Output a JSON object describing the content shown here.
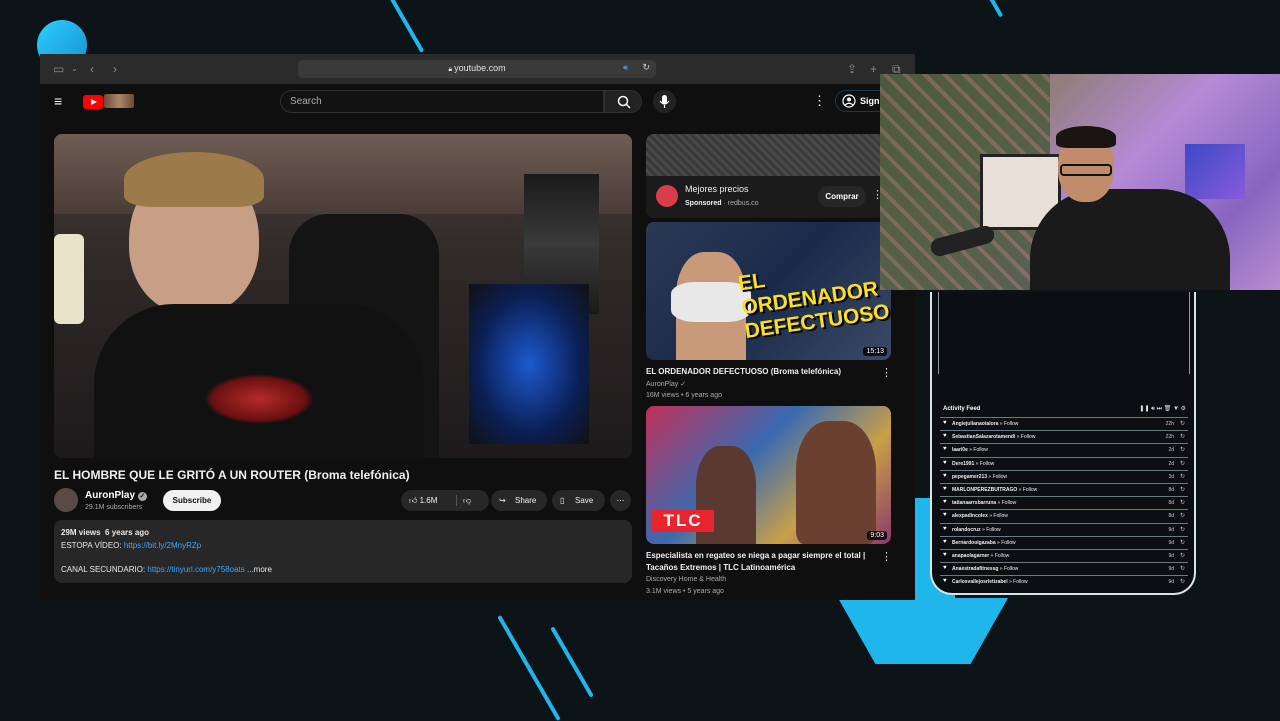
{
  "browser": {
    "url": "youtube.com"
  },
  "youtube": {
    "search_placeholder": "Search",
    "sign_in": "Sign",
    "video": {
      "title": "EL HOMBRE QUE LE GRITÓ A UN ROUTER (Broma telefónica)",
      "channel": "AuronPlay",
      "subscribers": "29.1M subscribers",
      "subscribe_label": "Subscribe",
      "likes": "1.6M",
      "share_label": "Share",
      "save_label": "Save",
      "views": "29M views",
      "age": "6 years ago",
      "desc_line1_prefix": "ESTOPA VÍDEO: ",
      "desc_line1_link": "https://bit.ly/2MnyRZp",
      "desc_line2_prefix": "CANAL SECUNDARIO: ",
      "desc_line2_link": "https://tinyurl.com/y758oats",
      "more_label": "...more"
    },
    "ad": {
      "title": "Mejores precios",
      "sponsored": "Sponsored",
      "domain": "redbus.co",
      "cta": "Comprar"
    },
    "recommendations": [
      {
        "title": "EL ORDENADOR DEFECTUOSO (Broma telefónica)",
        "channel": "AuronPlay",
        "meta": "16M views • 6 years ago",
        "duration": "15:13",
        "thumb_text": "EL ORDENADOR DEFECTUOSO"
      },
      {
        "title": "Especialista en regateo se niega a pagar siempre el total | Tacaños Extremos | TLC Latinoamérica",
        "channel": "Discovery Home & Health",
        "meta": "3.1M views • 5 years ago",
        "duration": "9:03",
        "thumb_text": "TLC"
      }
    ]
  },
  "activity_feed": {
    "title": "Activity Feed",
    "rows": [
      {
        "name": "Angiejulianaotalora",
        "action": "Follow",
        "time": "22h"
      },
      {
        "name": "SebastianSalazarotamendi",
        "action": "Follow",
        "time": "22h"
      },
      {
        "name": "laari0e",
        "action": "Follow",
        "time": "2d"
      },
      {
        "name": "Dere1991",
        "action": "Follow",
        "time": "2d"
      },
      {
        "name": "pepegamer213",
        "action": "Follow",
        "time": "3d"
      },
      {
        "name": "MARLONPEREZBUITRAGO",
        "action": "Follow",
        "time": "8d"
      },
      {
        "name": "tatianaarrsbarruna",
        "action": "Follow",
        "time": "8d"
      },
      {
        "name": "alexpadincolex",
        "action": "Follow",
        "time": "8d"
      },
      {
        "name": "rolandocruz",
        "action": "Follow",
        "time": "9d"
      },
      {
        "name": "Bernardoolgazaba",
        "action": "Follow",
        "time": "9d"
      },
      {
        "name": "anapaolagarner",
        "action": "Follow",
        "time": "9d"
      },
      {
        "name": "Anaestradafitnessg",
        "action": "Follow",
        "time": "9d"
      },
      {
        "name": "Carlosvallejosrletizabel",
        "action": "Follow",
        "time": "9d"
      }
    ]
  },
  "colors": {
    "accent": "#1fb6ec",
    "link": "#3ea6ff",
    "youtube_red": "#ff0000"
  }
}
